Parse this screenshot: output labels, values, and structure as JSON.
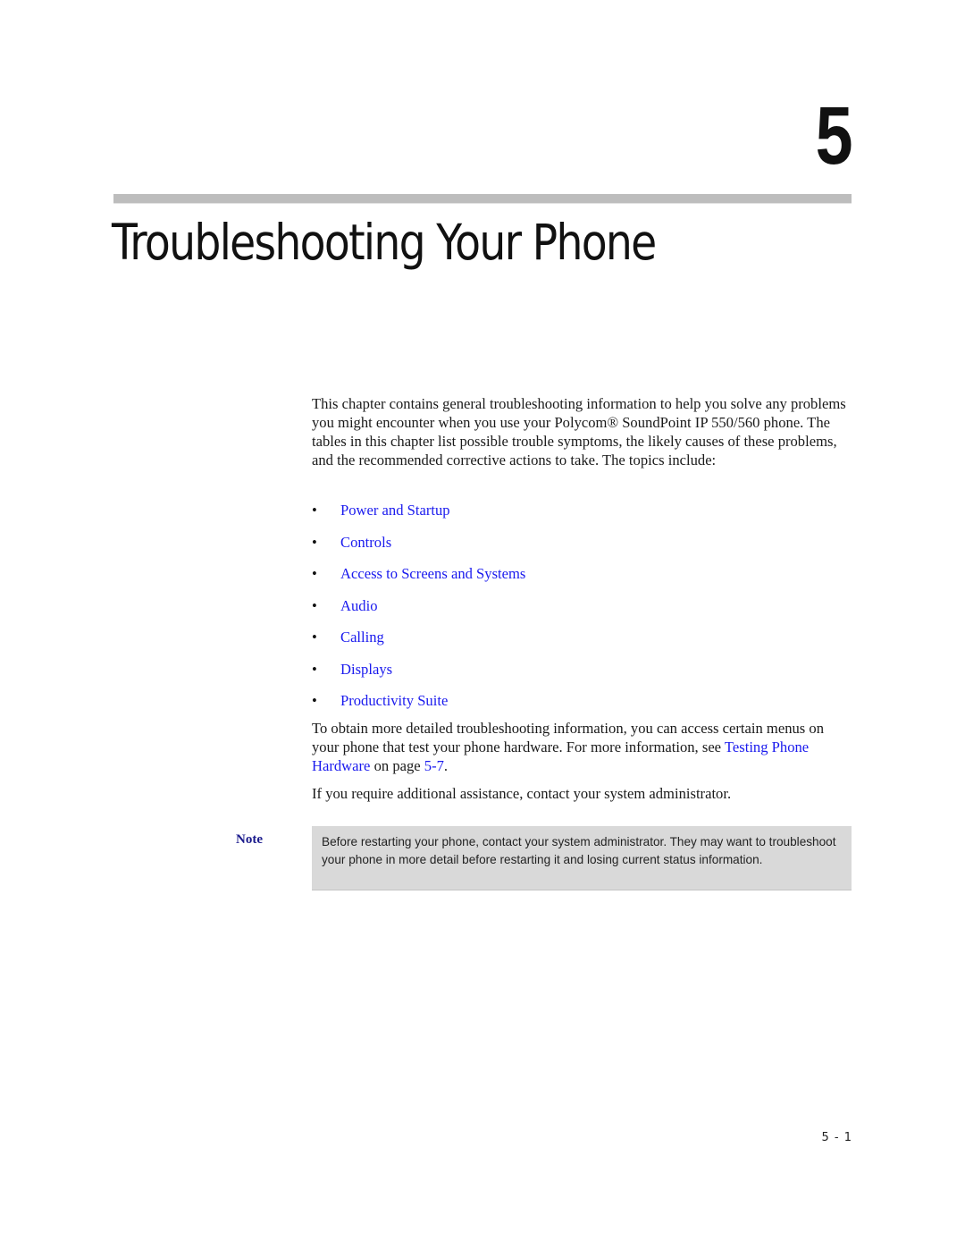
{
  "chapter": {
    "number": "5",
    "title": "Troubleshooting Your Phone"
  },
  "intro": "This chapter contains general troubleshooting information to help you solve any problems you might encounter when you use your Polycom® SoundPoint IP 550/560 phone. The tables in this chapter list possible trouble symptoms, the likely causes of these problems, and the recommended corrective actions to take. The topics include:",
  "topics": [
    {
      "bullet": "•",
      "label": "Power and Startup"
    },
    {
      "bullet": "•",
      "label": "Controls"
    },
    {
      "bullet": "•",
      "label": "Access to Screens and Systems"
    },
    {
      "bullet": "•",
      "label": "Audio"
    },
    {
      "bullet": "•",
      "label": "Calling"
    },
    {
      "bullet": "•",
      "label": "Displays"
    },
    {
      "bullet": "•",
      "label": "Productivity Suite"
    }
  ],
  "more_info": {
    "before": "To obtain more detailed troubleshooting information, you can access certain menus on your phone that test your phone hardware. For more information, see ",
    "link_label": "Testing Phone Hardware",
    "middle": " on page ",
    "page_link": "5-7",
    "after": "."
  },
  "assistance": "If you require additional assistance, contact your system administrator.",
  "note": {
    "label": "Note",
    "text": "Before restarting your phone, contact your system administrator. They may want to troubleshoot your phone in more detail before restarting it and losing current status information."
  },
  "footer": {
    "page_number": "5 - 1"
  },
  "colors": {
    "link": "#1a1aee",
    "note_label": "#1a1a8c",
    "note_background": "#d9d9d9",
    "rule": "#bdbdbd"
  }
}
